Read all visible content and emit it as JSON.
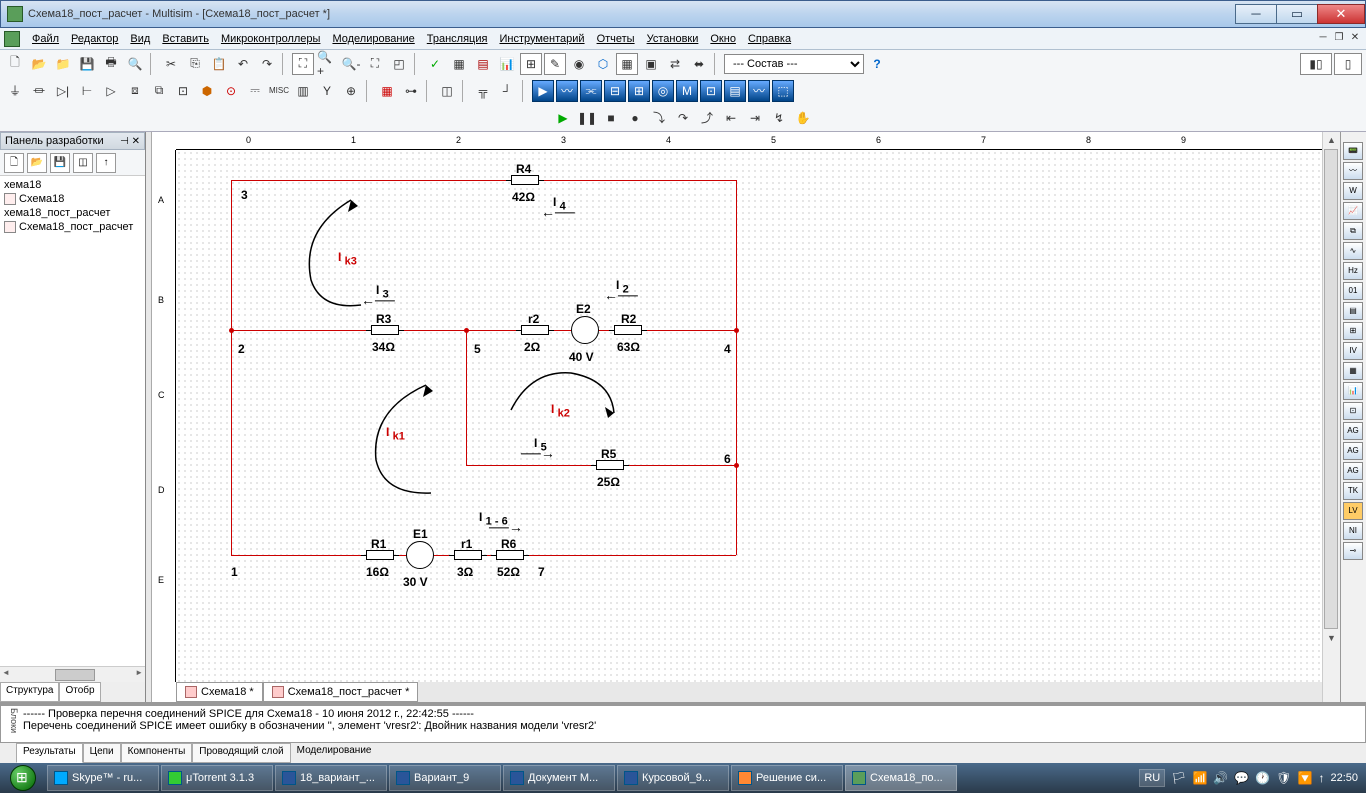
{
  "title": "Схема18_пост_расчет - Multisim - [Схема18_пост_расчет *]",
  "menu": [
    "Файл",
    "Редактор",
    "Вид",
    "Вставить",
    "Микроконтроллеры",
    "Моделирование",
    "Трансляция",
    "Инструментарий",
    "Отчеты",
    "Установки",
    "Окно",
    "Справка"
  ],
  "compose_combo": "--- Состав ---",
  "panel_title": "Панель разработки",
  "tree": [
    "хема18",
    "Схема18",
    "хема18_пост_расчет",
    "Схема18_пост_расчет"
  ],
  "left_tabs": [
    "Структура",
    "Отобр"
  ],
  "doc_tabs": [
    "Схема18 *",
    "Схема18_пост_расчет *"
  ],
  "ruler_h": [
    "0",
    "1",
    "2",
    "3",
    "4",
    "5",
    "6",
    "7",
    "8",
    "9"
  ],
  "ruler_v": [
    "A",
    "B",
    "C",
    "D",
    "E"
  ],
  "log": {
    "line1": "------ Проверка перечня соединений SPICE для Схема18 - 10 июня 2012 г., 22:42:55 ------",
    "line2": "Перечень соединений SPICE имеет ошибку в обозначении '', элемент 'vresr2':  Двойник названия модели 'vresr2'"
  },
  "log_tabs": [
    "Результаты",
    "Цепи",
    "Компоненты",
    "Проводящий слой",
    "Моделирование"
  ],
  "log_side": "Блоки",
  "taskbar": [
    "Skype™ - ru...",
    "μTorrent 3.1.3",
    "18_вариант_...",
    "Вариант_9",
    "Документ M...",
    "Курсовой_9...",
    "Решение си...",
    "Схема18_по..."
  ],
  "tray_lang": "RU",
  "tray_time": "22:50",
  "circuit": {
    "nodes": {
      "1": "1",
      "2": "2",
      "3": "3",
      "4": "4",
      "5": "5",
      "6": "6",
      "7": "7"
    },
    "R1": {
      "name": "R1",
      "val": "16Ω"
    },
    "R2": {
      "name": "R2",
      "val": "63Ω"
    },
    "R3": {
      "name": "R3",
      "val": "34Ω"
    },
    "R4": {
      "name": "R4",
      "val": "42Ω"
    },
    "R5": {
      "name": "R5",
      "val": "25Ω"
    },
    "R6": {
      "name": "R6",
      "val": "52Ω"
    },
    "r1": {
      "name": "r1",
      "val": "3Ω"
    },
    "r2": {
      "name": "r2",
      "val": "2Ω"
    },
    "E1": {
      "name": "E1",
      "val": "30 V"
    },
    "E2": {
      "name": "E2",
      "val": "40 V"
    },
    "Ik1": "I k1",
    "Ik2": "I k2",
    "Ik3": "I k3",
    "I1": "I 1 - 6",
    "I2": "I 2",
    "I3": "I 3",
    "I4": "I 4",
    "I5": "I 5"
  }
}
